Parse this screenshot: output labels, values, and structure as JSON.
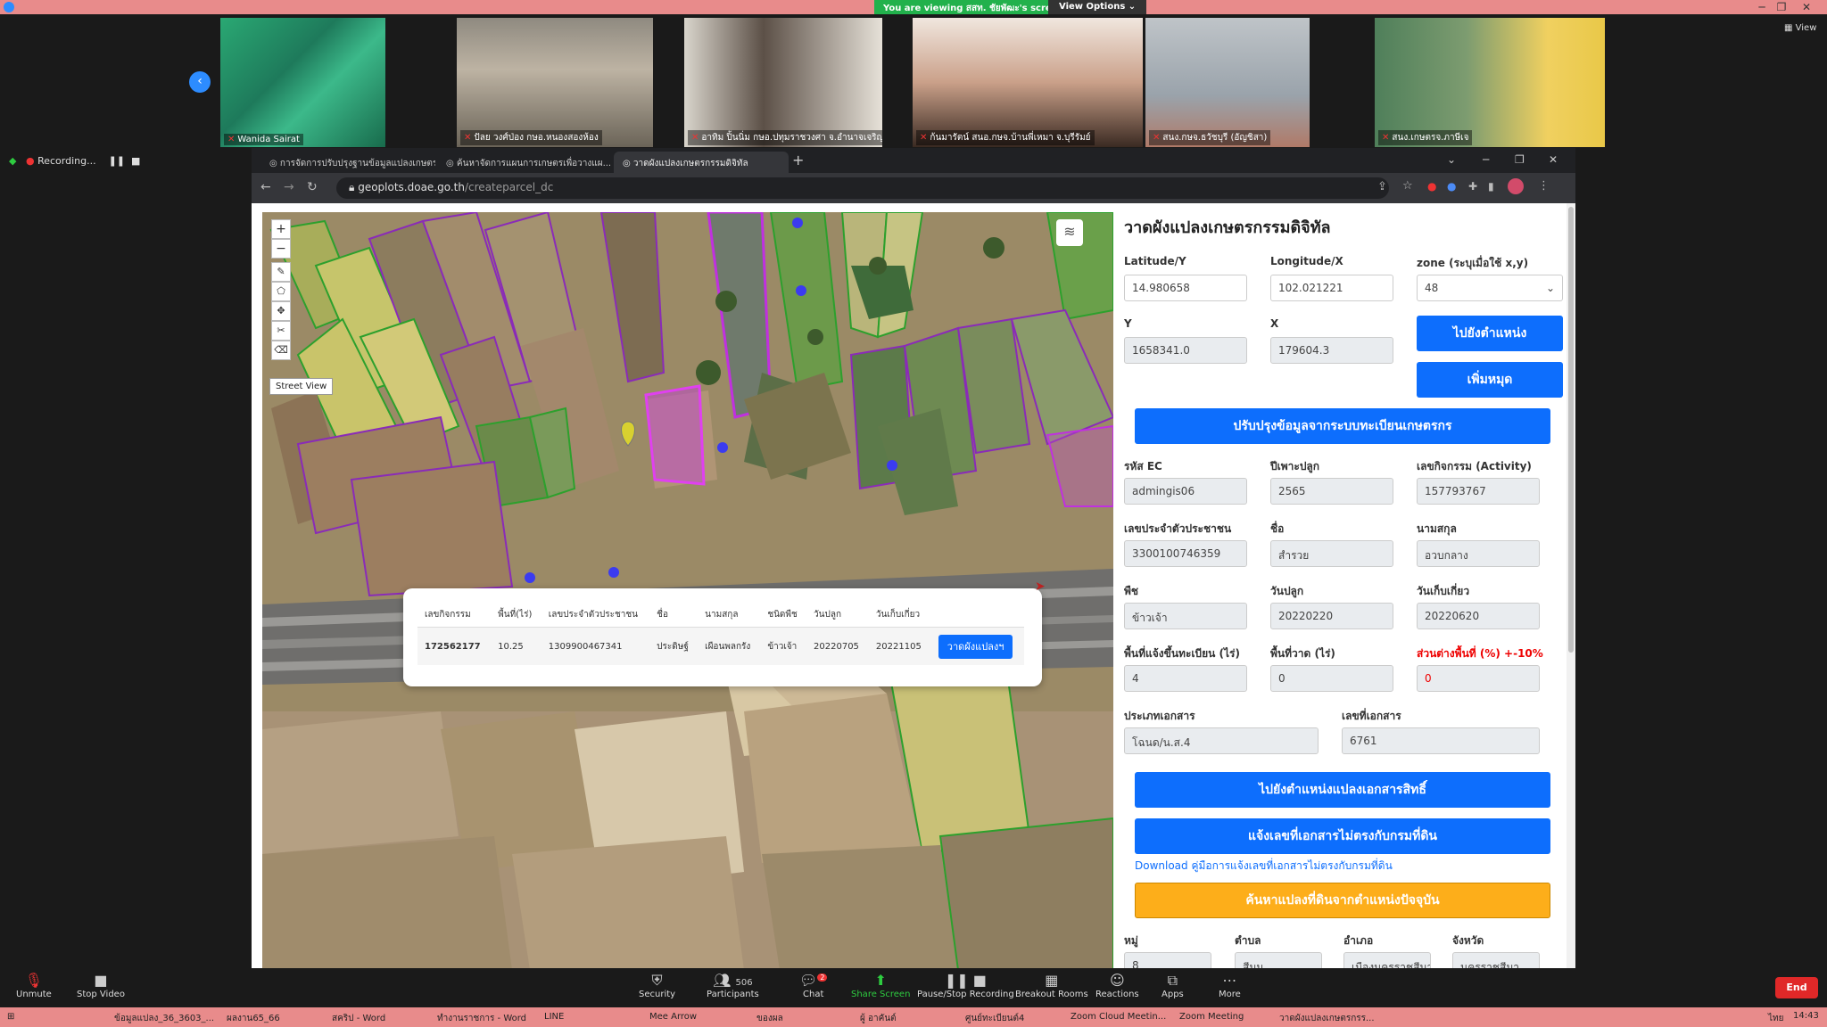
{
  "zoom": {
    "banner": "You are viewing สสท. ชัยพัฒะ's screen",
    "view_options": "View Options ⌄",
    "view_label": "View",
    "recording": "Recording...",
    "participants": [
      {
        "name": "Wanida Sairat"
      },
      {
        "name": "ปัลย วงศ์ป่อง กษอ.หนองสองห้อง"
      },
      {
        "name": "อาทิม ปิ้นนิ่ม กษอ.ปทุมราชวงศา จ.อำนาจเจริญ"
      },
      {
        "name": "ก้นมารัตน์ สนอ.กษจ.บ้านพี่เหมา จ.บุรีรัมย์"
      },
      {
        "name": "สนง.กษจ.ธวัชบุรี (อัญชิสา)"
      },
      {
        "name": "สนง.เกษตรจ.ภาษีเจ"
      }
    ],
    "bottom": {
      "unmute": "Unmute",
      "stop_video": "Stop Video",
      "security": "Security",
      "participants": "Participants",
      "participants_count": "506",
      "chat": "Chat",
      "chat_badge": "2",
      "share_screen": "Share Screen",
      "pause_recording": "Pause/Stop Recording",
      "breakout": "Breakout Rooms",
      "reactions": "Reactions",
      "apps": "Apps",
      "more": "More",
      "end": "End"
    }
  },
  "browser": {
    "tabs": [
      {
        "label": "การจัดการปรับปรุงฐานข้อมูลแปลงเกษตรกรรม"
      },
      {
        "label": "ค้นหาจัดการแผนการเกษตรเพื่อวางแผ..."
      },
      {
        "label": "วาดผังแปลงเกษตรกรรมดิจิทัล"
      }
    ],
    "url_host": "geoplots.doae.go.th",
    "url_path": "/createparcel_dc"
  },
  "map": {
    "street_view": "Street View",
    "popup": {
      "headers": [
        "เลขกิจกรรม",
        "พื้นที่(ไร่)",
        "เลขประจำตัวประชาชน",
        "ชื่อ",
        "นามสกุล",
        "ชนิดพืช",
        "วันปลูก",
        "วันเก็บเกี่ยว"
      ],
      "row": [
        "172562177",
        "10.25",
        "1309900467341",
        "ประดิษฐ์",
        "เผือนพลกรัง",
        "ข้าวเจ้า",
        "20220705",
        "20221105"
      ],
      "button": "วาดผังแปลงฯ"
    }
  },
  "form": {
    "title": "วาดผังแปลงเกษตรกรรมดิจิทัล",
    "lat_label": "Latitude/Y",
    "lat_value": "14.980658",
    "lon_label": "Longitude/X",
    "lon_value": "102.021221",
    "zone_label": "zone (ระบุเมื่อใช้ x,y)",
    "zone_value": "48",
    "y_label": "Y",
    "y_value": "1658341.0",
    "x_label": "X",
    "x_value": "179604.3",
    "goto_btn": "ไปยังตำแหน่ง",
    "add_pin_btn": "เพิ่มหมุด",
    "update_btn": "ปรับปรุงข้อมูลจากระบบทะเบียนเกษตรกร",
    "ec_label": "รหัส EC",
    "ec_value": "admingis06",
    "year_label": "ปีเพาะปลูก",
    "year_value": "2565",
    "activity_label": "เลขกิจกรรม (Activity)",
    "activity_value": "157793767",
    "pid_label": "เลขประจำตัวประชาชน",
    "pid_value": "3300100746359",
    "name_label": "ชื่อ",
    "name_value": "สำรวย",
    "surname_label": "นามสกุล",
    "surname_value": "อวบกลาง",
    "crop_label": "พืช",
    "crop_value": "ข้าวเจ้า",
    "plant_label": "วันปลูก",
    "plant_value": "20220220",
    "harvest_label": "วันเก็บเกี่ยว",
    "harvest_value": "20220620",
    "reg_area_label": "พื้นที่แจ้งขึ้นทะเบียน (ไร่)",
    "reg_area_value": "4",
    "draw_area_label": "พื้นที่วาด (ไร่)",
    "draw_area_value": "0",
    "diff_label": "ส่วนต่างพื้นที่ (%) +-10%",
    "diff_value": "0",
    "doc_type_label": "ประเภทเอกสาร",
    "doc_type_value": "โฉนด/น.ส.4",
    "doc_no_label": "เลขที่เอกสาร",
    "doc_no_value": "6761",
    "goto_doc_btn": "ไปยังตำแหน่งแปลงเอกสารสิทธิ์",
    "report_btn": "แจ้งเลขที่เอกสารไม่ตรงกับกรมที่ดิน",
    "download_link": "Download คู่มือการแจ้งเลขที่เอกสารไม่ตรงกับกรมที่ดิน",
    "search_btn": "ค้นหาแปลงที่ดินจากตำแหน่งปัจจุบัน",
    "moo_label": "หมู่",
    "moo_value": "8",
    "tambon_label": "ตำบล",
    "tambon_value": "สีมุม",
    "amphoe_label": "อำเภอ",
    "amphoe_value": "เมืองนครราชสีมา",
    "province_label": "จังหวัด",
    "province_value": "นครราชสีมา"
  },
  "taskbar": {
    "items": [
      "ข้อมูลแปลง_36_3603_...",
      "ผลงาน65_66",
      "สคริป - Word",
      "ทำงานราชการ - Word",
      "LINE",
      "Mee Arrow",
      "ของผล",
      "ผู้ อาคันต์",
      "ศูนย์ทะเบียนต์4",
      "Zoom Cloud Meetin...",
      "Zoom Meeting",
      "วาดผังแปลงเกษตรกรร..."
    ],
    "lang": "ไทย",
    "time": "14:43"
  },
  "colors": {
    "primary": "#0d6efd",
    "warning": "#fdae1a",
    "danger": "#e00000",
    "zoom_banner": "#22b14c",
    "zoom_topbar": "#e88b8b"
  }
}
